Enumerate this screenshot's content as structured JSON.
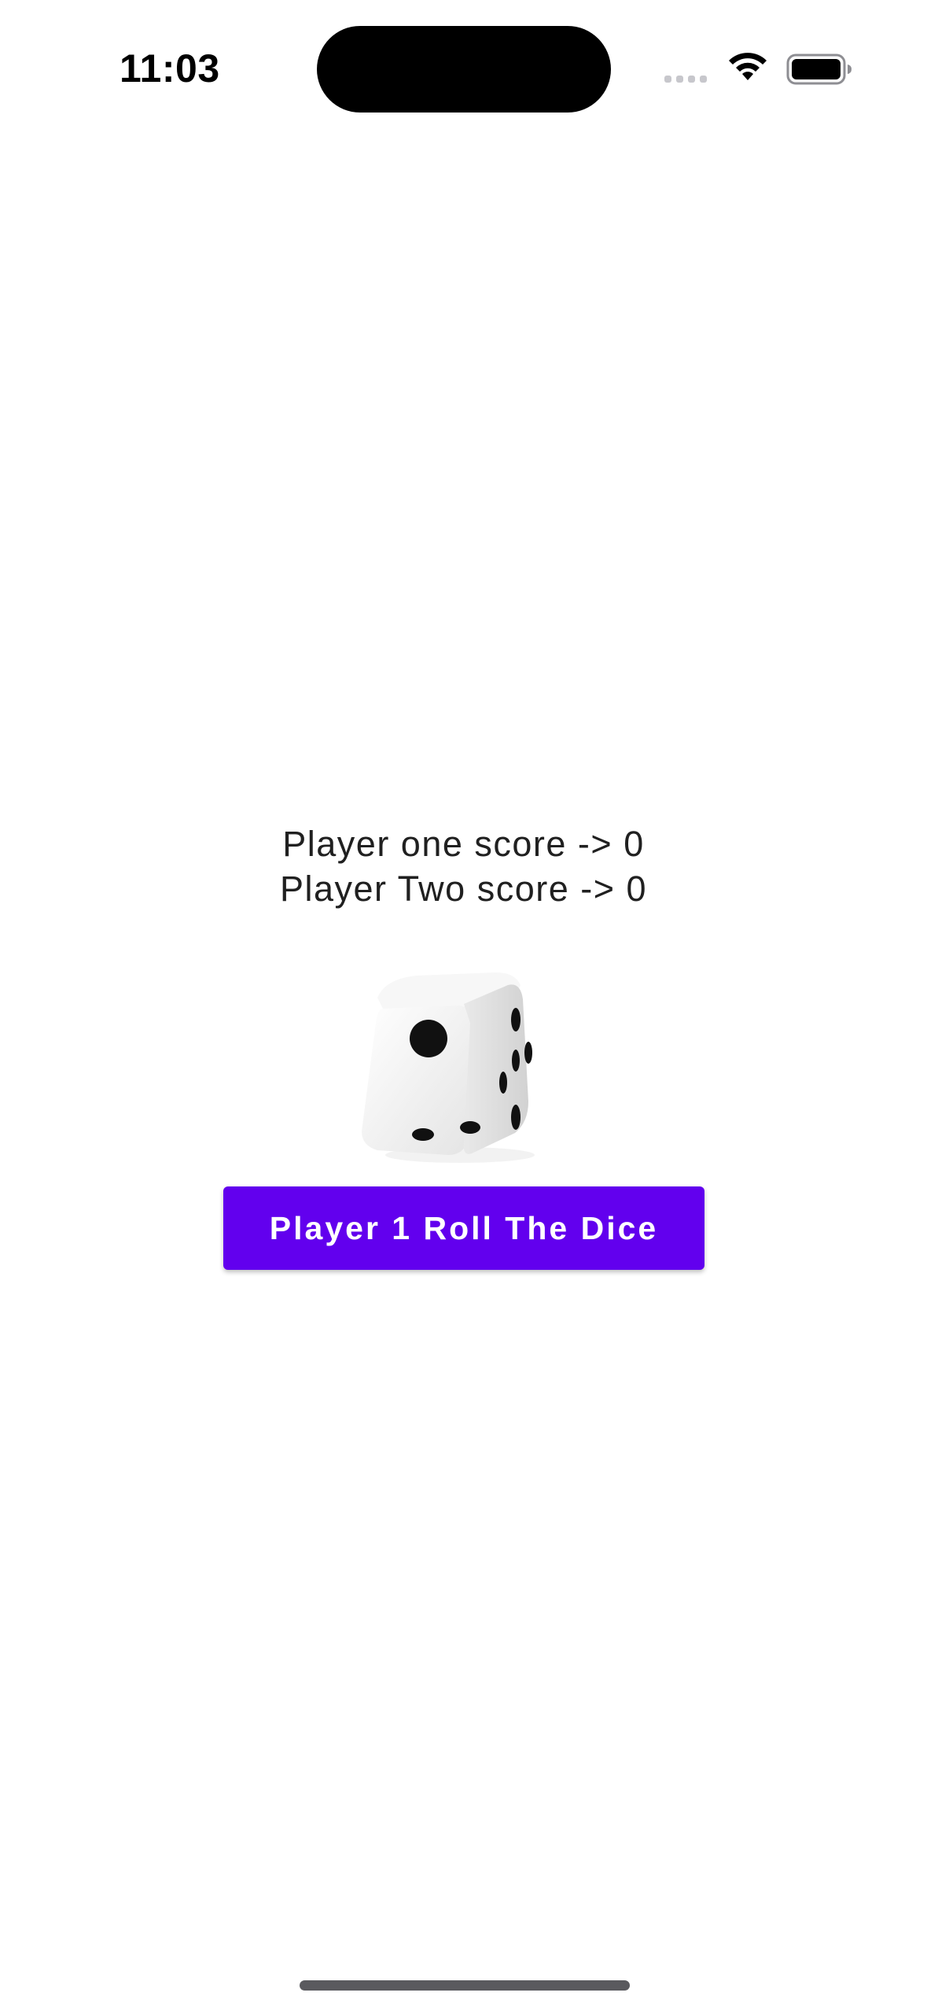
{
  "status_bar": {
    "time": "11:03",
    "icons": [
      "cellular-signal-icon",
      "wifi-icon",
      "battery-icon"
    ]
  },
  "scores": {
    "player_one": "Player one score -> 0",
    "player_two": "Player Two score -> 0"
  },
  "dice": {
    "icon": "dice-icon"
  },
  "roll_button": {
    "label": "Player 1 Roll The Dice",
    "color": "#6200ee"
  }
}
